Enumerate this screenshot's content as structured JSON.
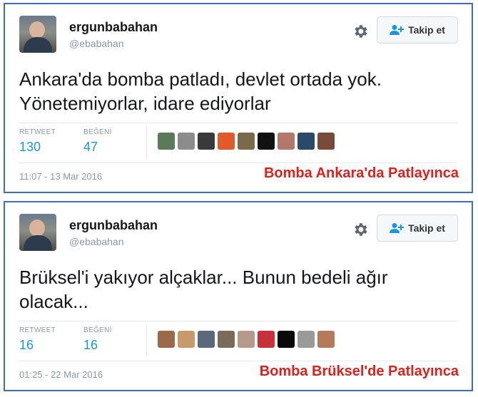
{
  "tweets": [
    {
      "user": {
        "name": "ergunbabahan",
        "handle": "@ebabahan"
      },
      "follow_label": "Takip et",
      "text": [
        "Ankara'da bomba patladı, devlet  ortada yok.",
        "Yönetemiyorlar, idare ediyorlar"
      ],
      "retweet_label": "RETWEET",
      "retweet_count": "130",
      "like_label": "BEĞENİ",
      "like_count": "47",
      "liker_colors": [
        "#5a7a5a",
        "#8c8c8c",
        "#3a3a3a",
        "#e05a2a",
        "#7a6a4a",
        "#111111",
        "#b4786a",
        "#2a4a6a",
        "#7a4a3a"
      ],
      "timestamp": "11:07 - 13 Mar 2016",
      "caption": "Bomba Ankara'da Patlayınca"
    },
    {
      "user": {
        "name": "ergunbabahan",
        "handle": "@ebabahan"
      },
      "follow_label": "Takip et",
      "text": [
        "Brüksel'i yakıyor alçaklar... Bunun bedeli ağır",
        "olacak..."
      ],
      "retweet_label": "RETWEET",
      "retweet_count": "16",
      "like_label": "BEĞENİ",
      "like_count": "16",
      "liker_colors": [
        "#9a6a4a",
        "#c89a6a",
        "#5a6a7a",
        "#7a6a5a",
        "#b49a8a",
        "#c8303a",
        "#0a0a0a",
        "#9a9a9a",
        "#b47a5a"
      ],
      "timestamp": "01:25 - 22 Mar 2016",
      "caption": "Bomba Brüksel'de Patlayınca"
    }
  ],
  "icons": {
    "settings": "gear-icon",
    "follow": "add-user-icon"
  },
  "colors": {
    "border": "#3b6fc0",
    "caption": "#e0201b",
    "count": "#1b95e0",
    "muted": "#8899a6"
  }
}
